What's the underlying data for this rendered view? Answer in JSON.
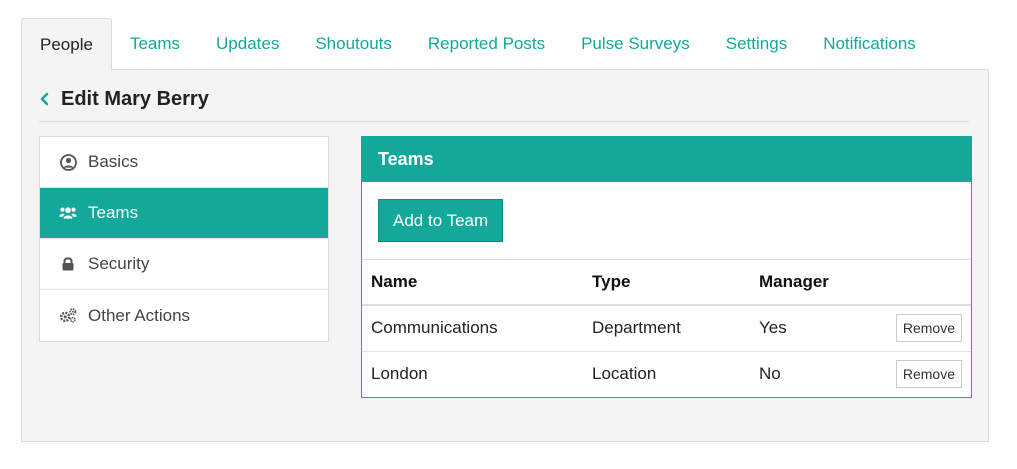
{
  "tabs": [
    {
      "label": "People",
      "active": true
    },
    {
      "label": "Teams"
    },
    {
      "label": "Updates"
    },
    {
      "label": "Shoutouts"
    },
    {
      "label": "Reported Posts"
    },
    {
      "label": "Pulse Surveys"
    },
    {
      "label": "Settings"
    },
    {
      "label": "Notifications"
    }
  ],
  "header": {
    "back_icon": "chevron-left-icon",
    "title": "Edit Mary Berry"
  },
  "sidenav": {
    "items": [
      {
        "label": "Basics",
        "icon": "user-circle-icon"
      },
      {
        "label": "Teams",
        "icon": "users-icon",
        "active": true
      },
      {
        "label": "Security",
        "icon": "lock-icon"
      },
      {
        "label": "Other Actions",
        "icon": "gears-icon"
      }
    ]
  },
  "teams_card": {
    "title": "Teams",
    "add_button": "Add to Team",
    "columns": [
      "Name",
      "Type",
      "Manager"
    ],
    "rows": [
      {
        "name": "Communications",
        "type": "Department",
        "manager": "Yes",
        "action": "Remove"
      },
      {
        "name": "London",
        "type": "Location",
        "manager": "No",
        "action": "Remove"
      }
    ]
  },
  "colors": {
    "accent": "#14a89a",
    "panel_bg": "#f4f4f4"
  }
}
